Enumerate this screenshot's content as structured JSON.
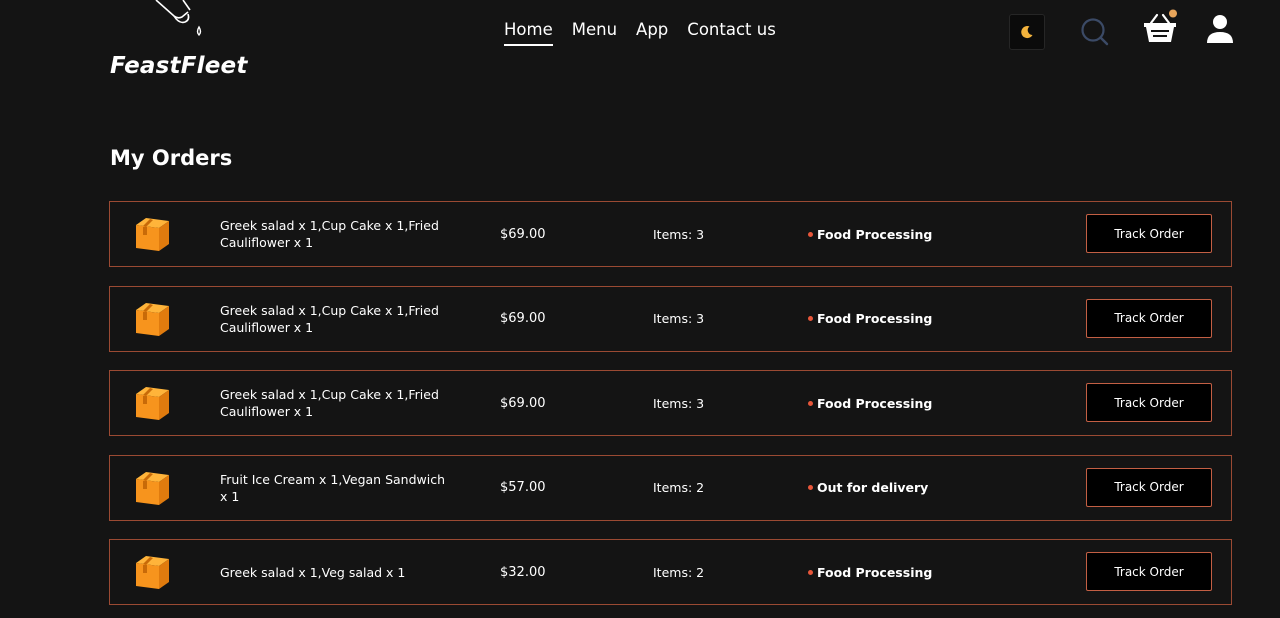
{
  "header": {
    "logo_text": "FeastFleet",
    "nav": [
      {
        "label": "Home",
        "active": true
      },
      {
        "label": "Menu",
        "active": false
      },
      {
        "label": "App",
        "active": false
      },
      {
        "label": "Contact us",
        "active": false
      }
    ],
    "icons": [
      "moon-icon",
      "search-icon",
      "basket-icon",
      "user-icon"
    ],
    "cart_has_items": true
  },
  "page": {
    "title": "My Orders"
  },
  "orders": [
    {
      "items": "Greek salad x 1,Cup Cake x 1,Fried Cauliflower x 1",
      "amount": "$69.00",
      "count": "Items: 3",
      "status": "Food Processing",
      "button": "Track Order"
    },
    {
      "items": "Greek salad x 1,Cup Cake x 1,Fried Cauliflower x 1",
      "amount": "$69.00",
      "count": "Items: 3",
      "status": "Food Processing",
      "button": "Track Order"
    },
    {
      "items": "Greek salad x 1,Cup Cake x 1,Fried Cauliflower x 1",
      "amount": "$69.00",
      "count": "Items: 3",
      "status": "Food Processing",
      "button": "Track Order"
    },
    {
      "items": "Fruit Ice Cream x 1,Vegan Sandwich x 1",
      "amount": "$57.00",
      "count": "Items: 2",
      "status": "Out for delivery",
      "button": "Track Order"
    },
    {
      "items": "Greek salad x 1,Veg salad x 1",
      "amount": "$32.00",
      "count": "Items: 2",
      "status": "Food Processing",
      "button": "Track Order"
    }
  ],
  "colors": {
    "background": "#141414",
    "row_border": "#9b4a33",
    "button_border": "#c35f44",
    "status_dot": "#e8563a",
    "parcel_orange": "#f7941d",
    "moon": "#f3b33d",
    "badge": "#e8a55a"
  }
}
